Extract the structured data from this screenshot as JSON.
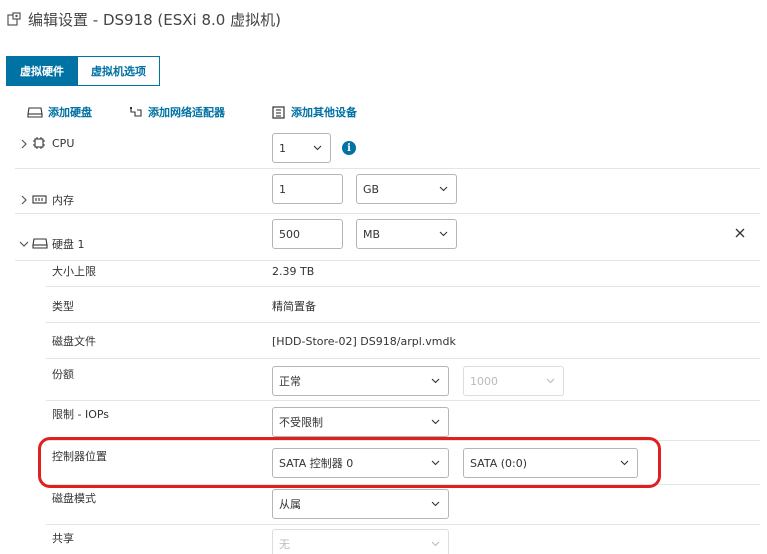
{
  "window": {
    "title": "编辑设置 - DS918 (ESXi 8.0 虚拟机)"
  },
  "tabs": [
    {
      "label": "虚拟硬件",
      "active": true
    },
    {
      "label": "虚拟机选项",
      "active": false
    }
  ],
  "toolbar": {
    "add_disk": "添加硬盘",
    "add_nic": "添加网络适配器",
    "add_other": "添加其他设备"
  },
  "cpu": {
    "label": "CPU",
    "value": "1"
  },
  "memory": {
    "label": "内存",
    "value": "1",
    "unit": "GB"
  },
  "disk": {
    "label": "硬盘 1",
    "size_value": "500",
    "size_unit": "MB",
    "max_size_label": "大小上限",
    "max_size_value": "2.39 TB",
    "type_label": "类型",
    "type_value": "精简置备",
    "file_label": "磁盘文件",
    "file_value": "[HDD-Store-02] DS918/arpl.vmdk",
    "shares_label": "份额",
    "shares_value": "正常",
    "shares_number": "1000",
    "iops_label": "限制 - IOPs",
    "iops_value": "不受限制",
    "controller_label": "控制器位置",
    "controller_value": "SATA 控制器 0",
    "controller_slot": "SATA (0:0)",
    "mode_label": "磁盘模式",
    "mode_value": "从属",
    "sharing_label": "共享",
    "sharing_value": "无"
  },
  "colors": {
    "accent": "#0072a3",
    "highlight": "#e02020"
  }
}
